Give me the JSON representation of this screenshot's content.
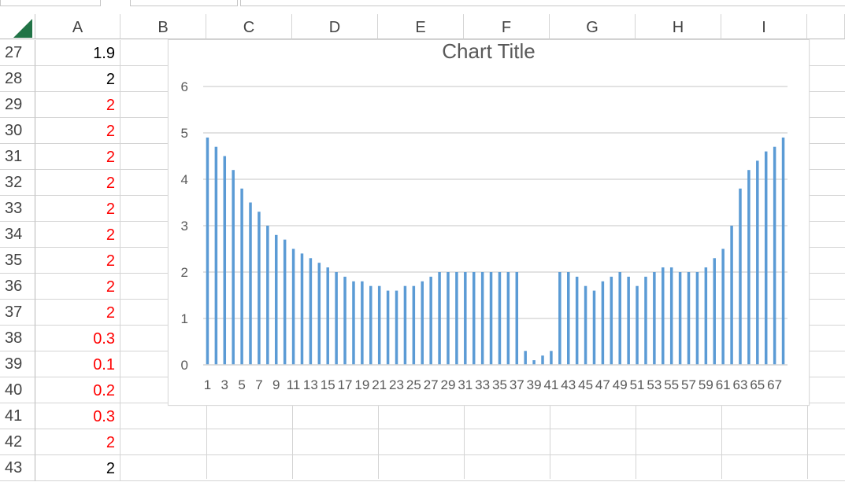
{
  "columns": [
    "A",
    "B",
    "C",
    "D",
    "E",
    "F",
    "G",
    "H",
    "I"
  ],
  "rows": [
    {
      "num": "27",
      "a": "1.9",
      "color": "#000000"
    },
    {
      "num": "28",
      "a": "2",
      "color": "#000000"
    },
    {
      "num": "29",
      "a": "2",
      "color": "#ff0000"
    },
    {
      "num": "30",
      "a": "2",
      "color": "#ff0000"
    },
    {
      "num": "31",
      "a": "2",
      "color": "#ff0000"
    },
    {
      "num": "32",
      "a": "2",
      "color": "#ff0000"
    },
    {
      "num": "33",
      "a": "2",
      "color": "#ff0000"
    },
    {
      "num": "34",
      "a": "2",
      "color": "#ff0000"
    },
    {
      "num": "35",
      "a": "2",
      "color": "#ff0000"
    },
    {
      "num": "36",
      "a": "2",
      "color": "#ff0000"
    },
    {
      "num": "37",
      "a": "2",
      "color": "#ff0000"
    },
    {
      "num": "38",
      "a": "0.3",
      "color": "#ff0000"
    },
    {
      "num": "39",
      "a": "0.1",
      "color": "#ff0000"
    },
    {
      "num": "40",
      "a": "0.2",
      "color": "#ff0000"
    },
    {
      "num": "41",
      "a": "0.3",
      "color": "#ff0000"
    },
    {
      "num": "42",
      "a": "2",
      "color": "#ff0000"
    },
    {
      "num": "43",
      "a": "2",
      "color": "#000000"
    }
  ],
  "colors": {
    "accent": "#217346",
    "bar": "#5b9bd5",
    "grid": "#d9d9d9",
    "text": "#595959"
  },
  "chart_data": {
    "type": "bar",
    "title": "Chart Title",
    "ylim": [
      0,
      6
    ],
    "yticks": [
      0,
      1,
      2,
      3,
      4,
      5,
      6
    ],
    "grid": true,
    "categories": [
      "1",
      "2",
      "3",
      "4",
      "5",
      "6",
      "7",
      "8",
      "9",
      "10",
      "11",
      "12",
      "13",
      "14",
      "15",
      "16",
      "17",
      "18",
      "19",
      "20",
      "21",
      "22",
      "23",
      "24",
      "25",
      "26",
      "27",
      "28",
      "29",
      "30",
      "31",
      "32",
      "33",
      "34",
      "35",
      "36",
      "37",
      "38",
      "39",
      "40",
      "41",
      "42",
      "43",
      "44",
      "45",
      "46",
      "47",
      "48",
      "49",
      "50",
      "51",
      "52",
      "53",
      "54",
      "55",
      "56",
      "57",
      "58",
      "59",
      "60",
      "61",
      "62",
      "63",
      "64",
      "65",
      "66",
      "67",
      "68"
    ],
    "xtick_labels": [
      "1",
      "3",
      "5",
      "7",
      "9",
      "11",
      "13",
      "15",
      "17",
      "19",
      "21",
      "23",
      "25",
      "27",
      "29",
      "31",
      "33",
      "35",
      "37",
      "39",
      "41",
      "43",
      "45",
      "47",
      "49",
      "51",
      "53",
      "55",
      "57",
      "59",
      "61",
      "63",
      "65",
      "67"
    ],
    "values": [
      4.9,
      4.7,
      4.5,
      4.2,
      3.8,
      3.5,
      3.3,
      3.0,
      2.8,
      2.7,
      2.5,
      2.4,
      2.3,
      2.2,
      2.1,
      2.0,
      1.9,
      1.8,
      1.8,
      1.7,
      1.7,
      1.6,
      1.6,
      1.7,
      1.7,
      1.8,
      1.9,
      2.0,
      2.0,
      2.0,
      2.0,
      2.0,
      2.0,
      2.0,
      2.0,
      2.0,
      2.0,
      0.3,
      0.1,
      0.2,
      0.3,
      2.0,
      2.0,
      1.9,
      1.7,
      1.6,
      1.8,
      1.9,
      2.0,
      1.9,
      1.7,
      1.9,
      2.0,
      2.1,
      2.1,
      2.0,
      2.0,
      2.0,
      2.1,
      2.3,
      2.5,
      3.0,
      3.8,
      4.2,
      4.4,
      4.6,
      4.7,
      4.9
    ]
  }
}
